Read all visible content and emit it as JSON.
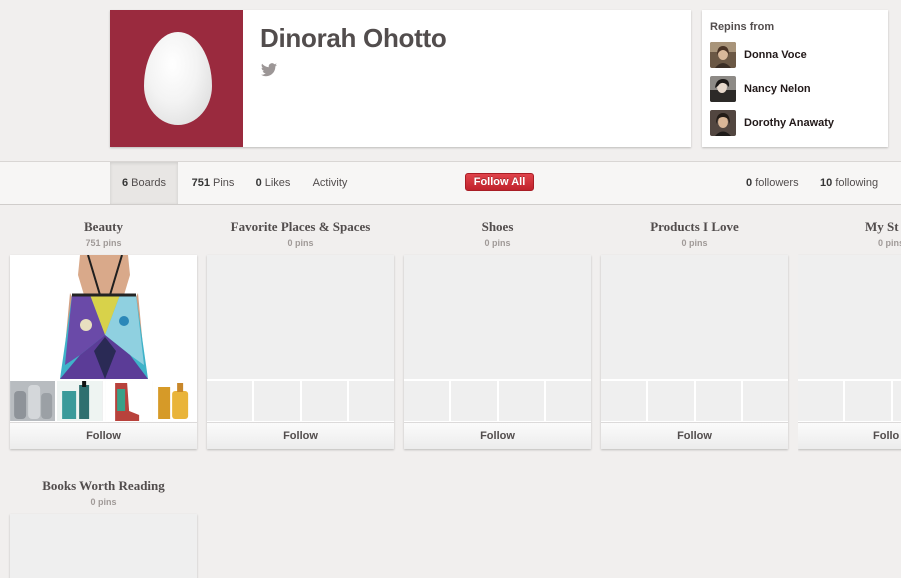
{
  "profile": {
    "name": "Dinorah Ohotto",
    "avatar_color": "#9a2a3e"
  },
  "repins": {
    "title": "Repins from",
    "users": [
      {
        "name": "Donna Voce"
      },
      {
        "name": "Nancy Nelon"
      },
      {
        "name": "Dorothy Anawaty"
      }
    ]
  },
  "nav": {
    "boards_count": "6",
    "boards_label": "Boards",
    "pins_count": "751",
    "pins_label": "Pins",
    "likes_count": "0",
    "likes_label": "Likes",
    "activity_label": "Activity",
    "follow_all_label": "Follow All",
    "followers_count": "0",
    "followers_label": "followers",
    "following_count": "10",
    "following_label": "following"
  },
  "boards": [
    {
      "title": "Beauty",
      "pins": "751 pins",
      "follow_label": "Follow"
    },
    {
      "title": "Favorite Places & Spaces",
      "pins": "0 pins",
      "follow_label": "Follow"
    },
    {
      "title": "Shoes",
      "pins": "0 pins",
      "follow_label": "Follow"
    },
    {
      "title": "Products I Love",
      "pins": "0 pins",
      "follow_label": "Follow"
    },
    {
      "title": "My St",
      "pins": "0 pins",
      "follow_label": "Follo"
    },
    {
      "title": "Books Worth Reading",
      "pins": "0 pins",
      "follow_label": "Follow"
    }
  ],
  "colors": {
    "accent_red": "#cb2027",
    "background": "#f1efee"
  }
}
